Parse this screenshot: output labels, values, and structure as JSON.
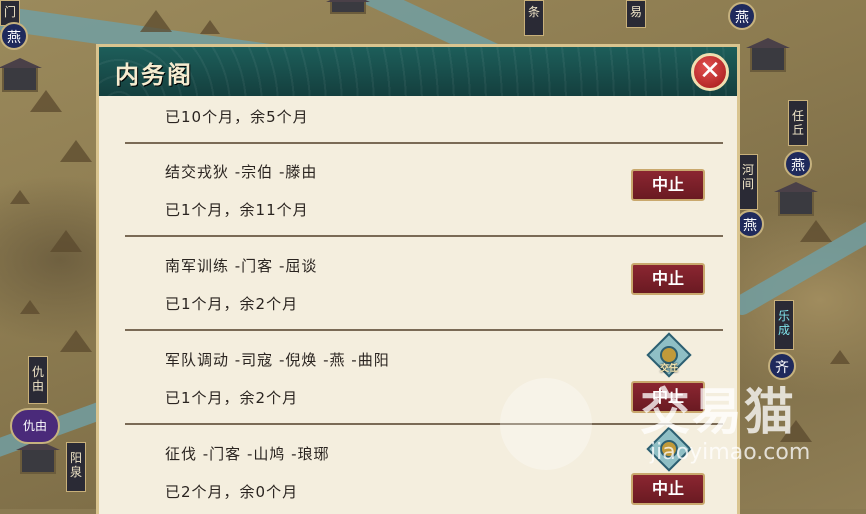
{
  "map": {
    "city_labels": [
      {
        "id": "men",
        "text": "门",
        "teal": false
      },
      {
        "id": "tiao",
        "text": "条",
        "teal": false
      },
      {
        "id": "yi",
        "text": "易",
        "teal": false
      },
      {
        "id": "renqiu",
        "text": "任丘",
        "teal": false
      },
      {
        "id": "hejian",
        "text": "河间",
        "teal": false
      },
      {
        "id": "lecheng",
        "text": "乐成",
        "teal": true
      },
      {
        "id": "qiuyou",
        "text": "仇由",
        "teal": false
      },
      {
        "id": "yangquan",
        "text": "阳泉",
        "teal": false
      }
    ],
    "nation_badges": {
      "yan1": "燕",
      "yan2": "燕",
      "yan3": "燕",
      "yan4": "燕",
      "qi": "齐",
      "qiuyou": "仇由"
    }
  },
  "dialog": {
    "title": "内务阁",
    "close_label": "✕",
    "rows": [
      {
        "task": "",
        "progress": "已10个月，余5个月",
        "action": ""
      },
      {
        "task": "结交戎狄 -宗伯 -滕由",
        "progress": "已1个月，余11个月",
        "action": "中止"
      },
      {
        "task": "南军训练 -门客 -屈谈",
        "progress": "已1个月，余2个月",
        "action": "中止"
      },
      {
        "task": "军队调动 -司寇 -倪焕 -燕 -曲阳",
        "progress": "已1个月，余2个月",
        "action": "中止",
        "badge": "交任"
      },
      {
        "task": "征伐 -门客 -山鸠 -琅琊",
        "progress": "已2个月，余0个月",
        "action": "中止",
        "badge": ""
      }
    ]
  },
  "watermark": {
    "text": "交易猫",
    "url": "jiaoyimao.com"
  }
}
